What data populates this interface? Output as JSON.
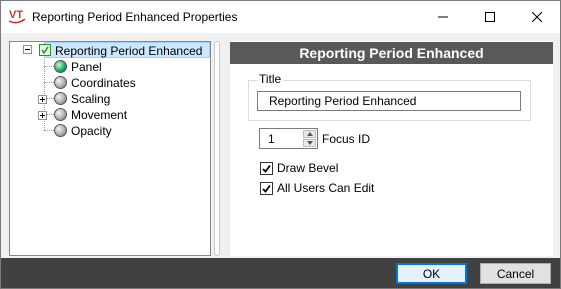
{
  "window": {
    "title": "Reporting Period Enhanced Properties",
    "logo_text": "VT"
  },
  "tree": {
    "root": {
      "label": "Reporting Period Enhanced",
      "expanded": true,
      "icon": "checklist-icon"
    },
    "children": [
      {
        "label": "Panel",
        "status_icon": "green-ball-icon",
        "expandable": false
      },
      {
        "label": "Coordinates",
        "status_icon": "gray-ball-icon",
        "expandable": false
      },
      {
        "label": "Scaling",
        "status_icon": "gray-ball-icon",
        "expandable": true
      },
      {
        "label": "Movement",
        "status_icon": "gray-ball-icon",
        "expandable": true
      },
      {
        "label": "Opacity",
        "status_icon": "gray-ball-icon",
        "expandable": false
      }
    ]
  },
  "panel": {
    "header": "Reporting Period Enhanced",
    "title_group_label": "Title",
    "title_value": "Reporting Period Enhanced",
    "focus_id_value": "1",
    "focus_id_label": "Focus ID",
    "draw_bevel_label": "Draw Bevel",
    "draw_bevel_checked": true,
    "all_users_edit_label": "All Users Can Edit",
    "all_users_edit_checked": true
  },
  "buttons": {
    "ok": "OK",
    "cancel": "Cancel"
  },
  "colors": {
    "header_bg": "#595959",
    "bottom_bar_bg": "#414141",
    "selection_bg": "#cce8ff",
    "default_button_border": "#0078d7"
  }
}
